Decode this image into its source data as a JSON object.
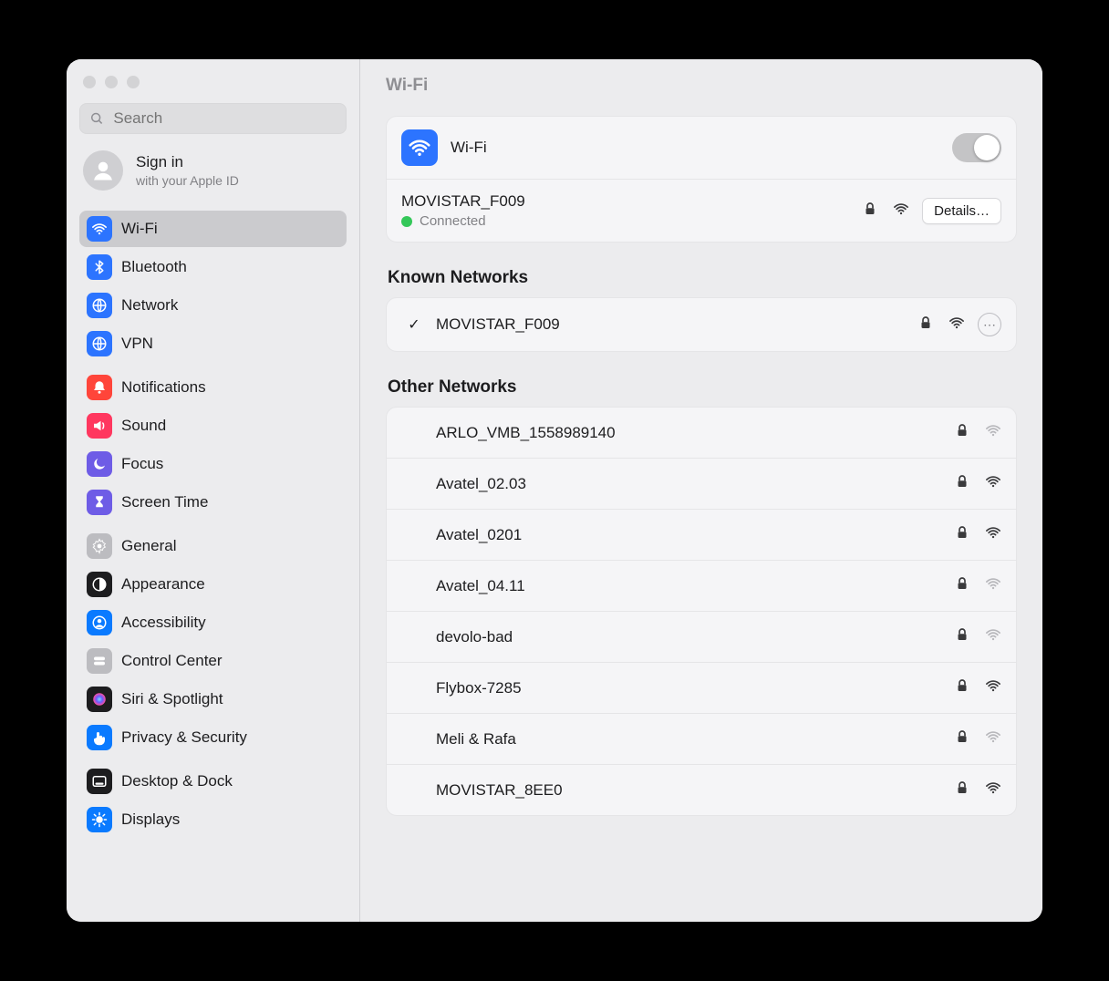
{
  "header": {
    "title": "Wi-Fi"
  },
  "search": {
    "placeholder": "Search"
  },
  "account": {
    "sign_in": "Sign in",
    "subtitle": "with your Apple ID"
  },
  "sidebar": {
    "groups": [
      {
        "items": [
          {
            "label": "Wi-Fi",
            "icon": "wifi",
            "color": "#2C74FF",
            "selected": true
          },
          {
            "label": "Bluetooth",
            "icon": "bluetooth",
            "color": "#2C74FF"
          },
          {
            "label": "Network",
            "icon": "globe",
            "color": "#2C74FF"
          },
          {
            "label": "VPN",
            "icon": "globe",
            "color": "#2C74FF"
          }
        ]
      },
      {
        "items": [
          {
            "label": "Notifications",
            "icon": "bell",
            "color": "#FF453A"
          },
          {
            "label": "Sound",
            "icon": "speaker",
            "color": "#FF375F"
          },
          {
            "label": "Focus",
            "icon": "moon",
            "color": "#6E5CE6"
          },
          {
            "label": "Screen Time",
            "icon": "hourglass",
            "color": "#6E5CE6"
          }
        ]
      },
      {
        "items": [
          {
            "label": "General",
            "icon": "gear",
            "color": "#BCBCC0"
          },
          {
            "label": "Appearance",
            "icon": "contrast",
            "color": "#1d1d1f"
          },
          {
            "label": "Accessibility",
            "icon": "person",
            "color": "#0A7AFF"
          },
          {
            "label": "Control Center",
            "icon": "switches",
            "color": "#BCBCC0"
          },
          {
            "label": "Siri & Spotlight",
            "icon": "siri",
            "color": "#1d1d1f"
          },
          {
            "label": "Privacy & Security",
            "icon": "hand",
            "color": "#0A7AFF"
          }
        ]
      },
      {
        "items": [
          {
            "label": "Desktop & Dock",
            "icon": "dock",
            "color": "#1d1d1f"
          },
          {
            "label": "Displays",
            "icon": "display",
            "color": "#0A7AFF"
          }
        ]
      }
    ]
  },
  "wifi_card": {
    "label": "Wi-Fi",
    "enabled": true,
    "connected_network": "MOVISTAR_F009",
    "status": "Connected",
    "secured": true,
    "signal": "strong",
    "details_label": "Details…"
  },
  "known": {
    "title": "Known Networks",
    "items": [
      {
        "name": "MOVISTAR_F009",
        "secured": true,
        "signal": "strong",
        "checked": true
      }
    ]
  },
  "other": {
    "title": "Other Networks",
    "items": [
      {
        "name": "ARLO_VMB_1558989140",
        "secured": true,
        "signal": "weak"
      },
      {
        "name": "Avatel_02.03",
        "secured": true,
        "signal": "strong"
      },
      {
        "name": "Avatel_0201",
        "secured": true,
        "signal": "strong"
      },
      {
        "name": "Avatel_04.11",
        "secured": true,
        "signal": "weak"
      },
      {
        "name": "devolo-bad",
        "secured": true,
        "signal": "weak"
      },
      {
        "name": "Flybox-7285",
        "secured": true,
        "signal": "strong"
      },
      {
        "name": "Meli & Rafa",
        "secured": true,
        "signal": "weak"
      },
      {
        "name": "MOVISTAR_8EE0",
        "secured": true,
        "signal": "strong"
      }
    ]
  }
}
